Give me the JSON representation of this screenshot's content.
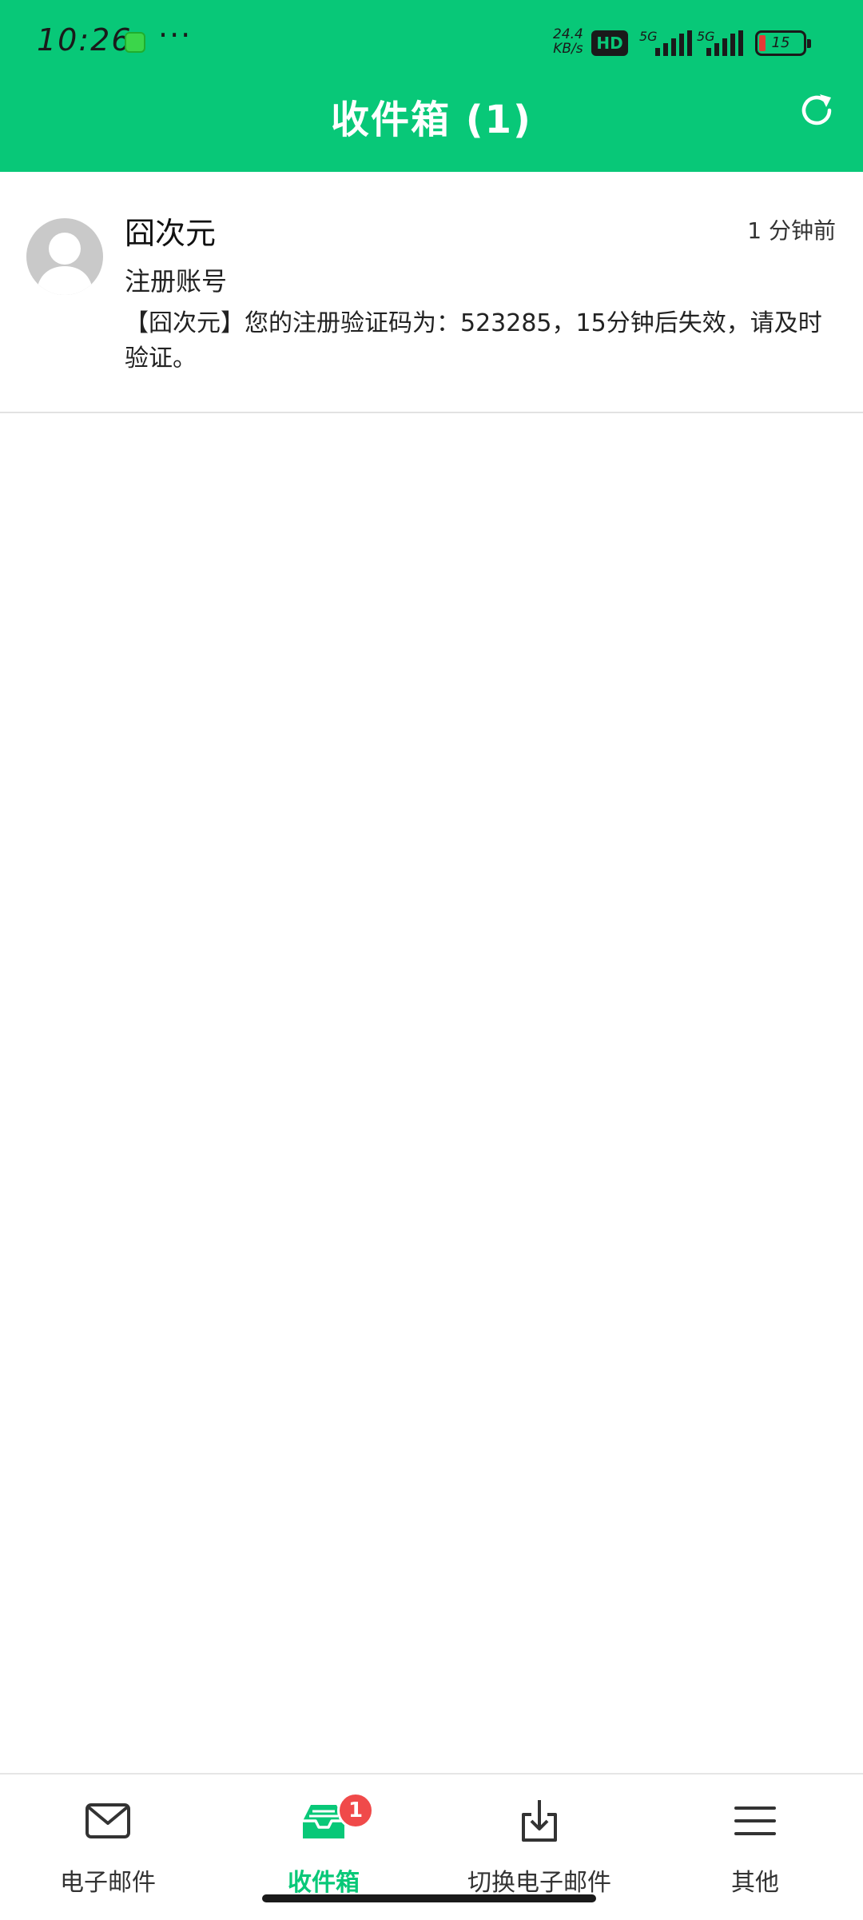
{
  "status_bar": {
    "time": "10:26",
    "more": "···",
    "speed_value": "24.4",
    "speed_unit": "KB/s",
    "hd": "HD",
    "net1": "5G",
    "net2": "5G",
    "battery": "15"
  },
  "header": {
    "title": "收件箱 (1)"
  },
  "mail_list": [
    {
      "sender": "囧次元",
      "time": "1 分钟前",
      "subject": "注册账号",
      "preview": "【囧次元】您的注册验证码为：523285，15分钟后失效，请及时验证。"
    }
  ],
  "tabs": [
    {
      "label": "电子邮件",
      "icon": "mail-icon"
    },
    {
      "label": "收件箱",
      "icon": "inbox-icon",
      "badge": "1",
      "active": true
    },
    {
      "label": "切换电子邮件",
      "icon": "download-icon"
    },
    {
      "label": "其他",
      "icon": "menu-icon"
    }
  ],
  "colors": {
    "accent": "#08c878",
    "badge": "#f04a4a"
  }
}
